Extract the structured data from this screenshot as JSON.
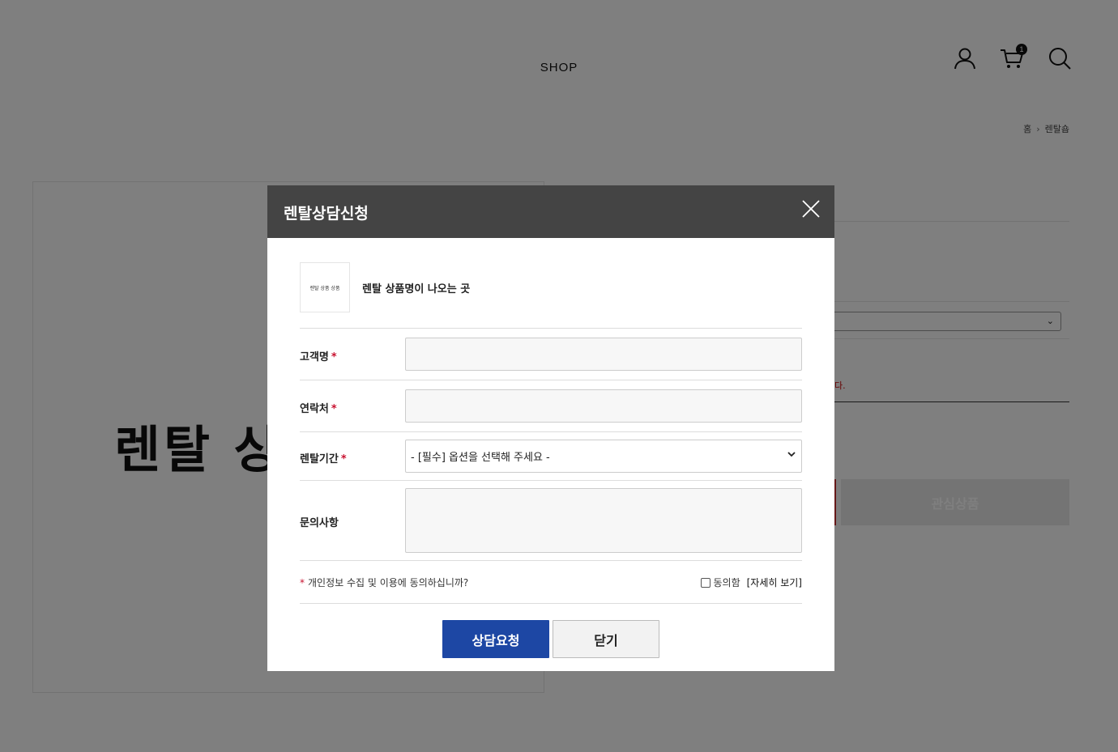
{
  "header": {
    "nav_shop": "SHOP",
    "cart_count": "1",
    "icons": [
      "user-icon",
      "cart-icon",
      "search-icon"
    ]
  },
  "breadcrumb": {
    "home": "홈",
    "current": "렌탈숍"
  },
  "product_image": {
    "text": "렌탈 상품 상품"
  },
  "background_page": {
    "notice_fragment": "다.",
    "wish_button": "관심상품"
  },
  "modal": {
    "title": "렌탈상담신청",
    "product": {
      "thumb_text": "렌탈 상품 상품",
      "name": "렌탈 상품명이 나오는 곳"
    },
    "fields": {
      "name_label": "고객명",
      "contact_label": "연락처",
      "period_label": "렌탈기간",
      "period_selected": "- [필수] 옵션을 선택해 주세요 -",
      "inquiry_label": "문의사항",
      "required_mark": "*"
    },
    "agreement": {
      "question": "개인정보 수집 및 이용에 동의하십니까?",
      "agree_label": "동의함",
      "detail_link": "[자세히 보기]"
    },
    "buttons": {
      "submit": "상담요청",
      "close": "닫기"
    }
  },
  "colors": {
    "modal_header": "#444444",
    "submit_button": "#1d47a4",
    "required": "#c8102e",
    "overlay": "rgba(0,0,0,0.5)"
  }
}
